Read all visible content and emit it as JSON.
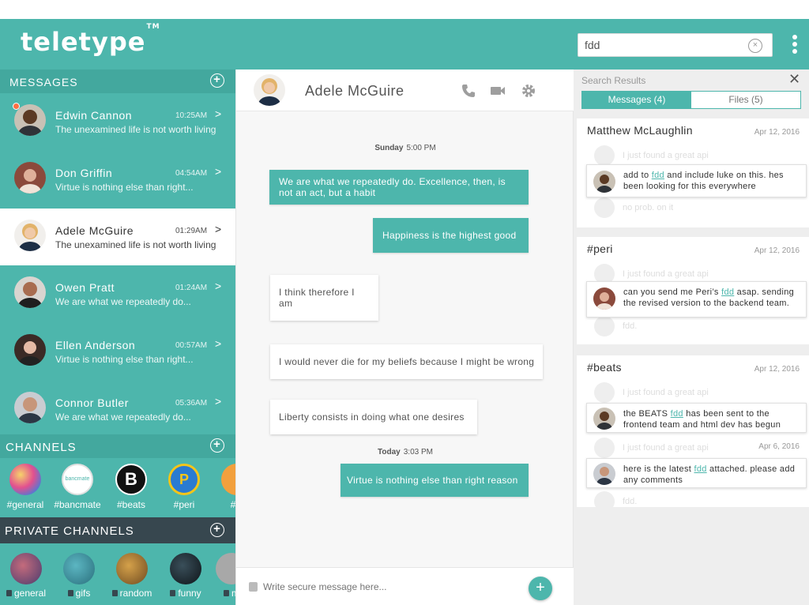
{
  "app": {
    "logo": "teletype",
    "tm": "TM",
    "search_value": "fdd",
    "clear": "×"
  },
  "messages_section": {
    "title": "MESSAGES"
  },
  "conversations": [
    {
      "name": "Edwin Cannon",
      "time": "10:25AM",
      "preview": "The unexamined life is not worth living",
      "unread": true,
      "skin": "#5b3a24"
    },
    {
      "name": "Don Griffin",
      "time": "04:54AM",
      "preview": "Virtue is nothing else than right...",
      "unread": false,
      "skin": "#c98a6a"
    },
    {
      "name": "Adele McGuire",
      "time": "01:29AM",
      "preview": "The unexamined life is not worth living",
      "unread": false,
      "skin": "#e0a878"
    },
    {
      "name": "Owen Pratt",
      "time": "01:24AM",
      "preview": "We are what we repeatedly do...",
      "unread": false,
      "skin": "#a86c4f"
    },
    {
      "name": "Ellen Anderson",
      "time": "00:57AM",
      "preview": "Virtue is nothing else than right...",
      "unread": false,
      "skin": "#d8a590"
    },
    {
      "name": "Connor Butler",
      "time": "05:36AM",
      "preview": "We are what we repeatedly do...",
      "unread": false,
      "skin": "#c7967a"
    }
  ],
  "channels_section": {
    "title": "CHANNELS"
  },
  "channels": [
    {
      "label": "#general",
      "color": "#c94f9d"
    },
    {
      "label": "#bancmate",
      "color": "#ffffff"
    },
    {
      "label": "#beats",
      "color": "#111111"
    },
    {
      "label": "#peri",
      "color": "#2a7bd1"
    },
    {
      "label": "#fu",
      "color": "#f2a03d"
    }
  ],
  "private_section": {
    "title": "PRIVATE CHANNELS"
  },
  "private_channels": [
    {
      "label": "general",
      "color": "#7a4b6e"
    },
    {
      "label": "gifs",
      "color": "#3c8c98"
    },
    {
      "label": "random",
      "color": "#9a6a2c"
    },
    {
      "label": "funny",
      "color": "#1b2a33"
    },
    {
      "label": "m",
      "color": "#a8a8a8"
    }
  ],
  "chat": {
    "contact": "Adele McGuire",
    "day1": {
      "day": "Sunday",
      "time": "5:00 PM"
    },
    "day2": {
      "day": "Today",
      "time": "3:03 PM"
    },
    "messages": [
      {
        "dir": "out",
        "text": "We are what we repeatedly do. Excellence, then, is not an act, but a habit"
      },
      {
        "dir": "out",
        "text": "Happiness is the highest good"
      },
      {
        "dir": "in",
        "text": "I think therefore I am"
      },
      {
        "dir": "in",
        "text": "I would never die for my beliefs because I might be wrong"
      },
      {
        "dir": "in",
        "text": "Liberty consists in doing what one desires"
      },
      {
        "dir": "out",
        "text": "Virtue is nothing else than right reason"
      }
    ],
    "composer_placeholder": "Write secure message here...",
    "send": "+"
  },
  "results": {
    "title": "Search Results",
    "close": "✕",
    "tab_messages": "Messages (4)",
    "tab_files": "Files (5)",
    "ghost_text": "I just found a great api",
    "ghost_ok": "no prob. on it",
    "ghost_fdd": "fdd.",
    "cards": [
      {
        "name": "Matthew McLaughlin",
        "date": "Apr 12, 2016",
        "hit_before": "add to ",
        "hit_term": "fdd",
        "hit_after": " and include luke on this. hes been looking for this everywhere"
      },
      {
        "name": "#peri",
        "date": "Apr 12, 2016",
        "hit_before": "can you send me Peri’s ",
        "hit_term": "fdd",
        "hit_after": " asap. sending the revised version to the backend team."
      },
      {
        "name": "#beats",
        "date": "Apr 12, 2016",
        "date2": "Apr 6, 2016",
        "hit_before": "the BEATS ",
        "hit_term": "fdd",
        "hit_after": " has been sent to the frontend team and html dev has begun",
        "hit2_before": "here is the latest ",
        "hit2_term": "fdd",
        "hit2_after": " attached. please add any comments"
      }
    ]
  }
}
